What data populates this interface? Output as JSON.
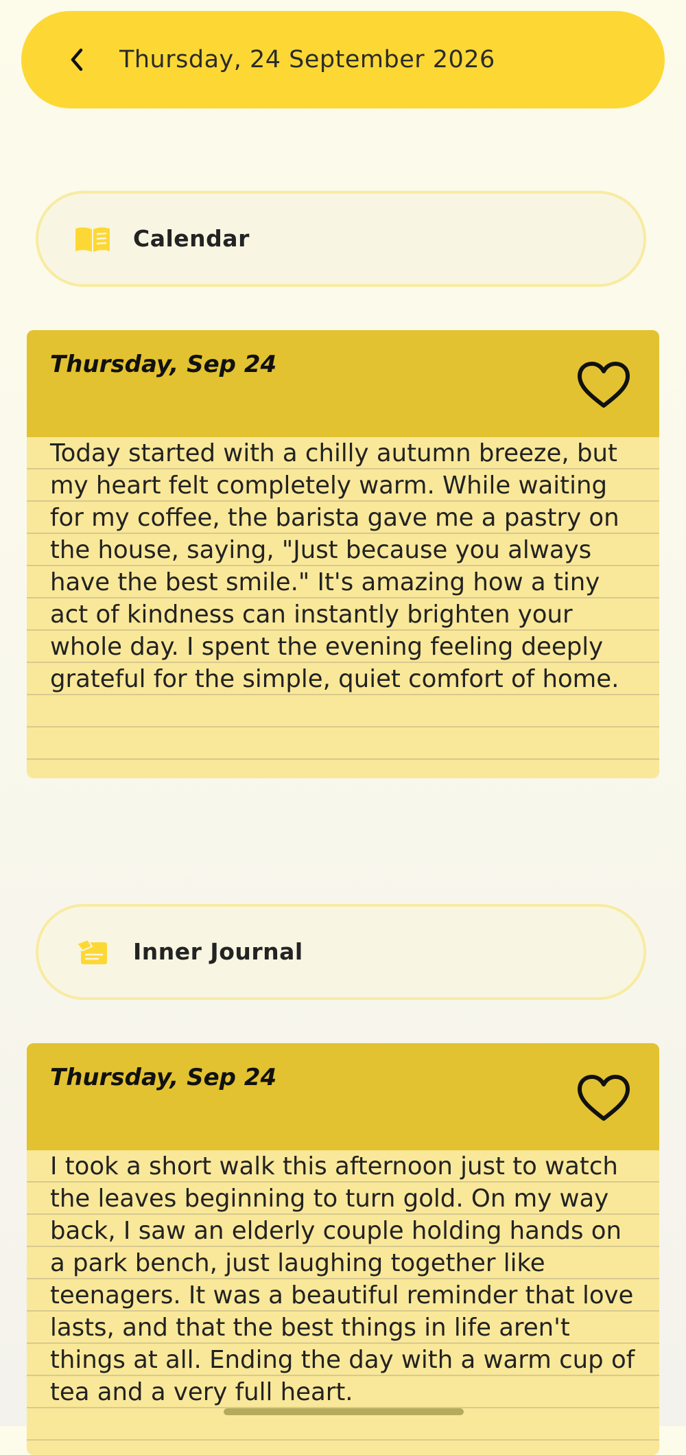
{
  "header": {
    "title": "Thursday, 24 September 2026",
    "back_icon": "chevron-left-icon"
  },
  "sections": [
    {
      "label": "Calendar",
      "icon": "book-icon",
      "icon_color": "#fdd835",
      "entry": {
        "date": "Thursday, Sep 24",
        "favorite_icon": "heart-outline-icon",
        "text": "Today started with a chilly autumn breeze, but my heart felt completely warm. While waiting for my coffee, the barista gave me a pastry on the house, saying, \"Just because you always have the best smile.\" It's amazing how a tiny act of kindness can instantly brighten your whole day. I spent the evening feeling deeply grateful for the simple, quiet comfort of home."
      }
    },
    {
      "label": "Inner Journal",
      "icon": "edit-note-icon",
      "icon_color": "#fdd835",
      "entry": {
        "date": "Thursday, Sep 24",
        "favorite_icon": "heart-outline-icon",
        "text": "I took a short walk this afternoon just to watch the leaves beginning to turn gold. On my way back, I saw an elderly couple holding hands on a park bench, just laughing together like teenagers. It was a beautiful reminder that love lasts, and that the best things in life aren't things at all. Ending the day with a warm cup of tea and a very full heart."
      }
    }
  ],
  "colors": {
    "accent": "#fdd835",
    "card_header": "#e2c230",
    "card_body": "#f9e899",
    "pill_border": "#f8eba2",
    "background": "#fdfbea"
  }
}
